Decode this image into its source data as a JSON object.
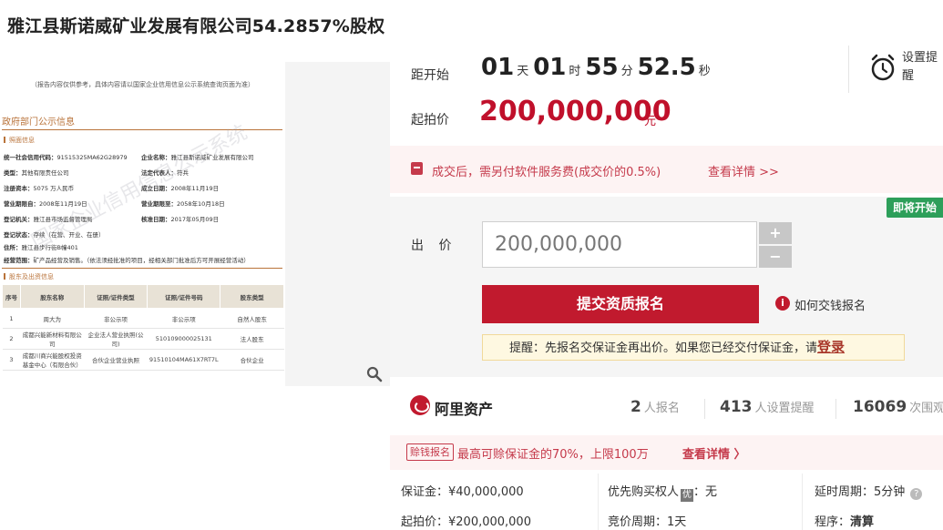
{
  "page": {
    "title": "雅江县斯诺威矿业发展有限公司54.2857%股权"
  },
  "document": {
    "note": "（报告内容仅供参考，具体内容请以国家企业信用信息公示系统查询页面为准）",
    "section_title": "政府部门公示信息",
    "license_section": "照面信息",
    "fields": [
      {
        "label": "统一社会信用代码：",
        "value": "91515325MA62G28979"
      },
      {
        "label": "企业名称：",
        "value": "雅江县斯诺威矿业发展有限公司"
      },
      {
        "label": "类型：",
        "value": "其他有限责任公司"
      },
      {
        "label": "法定代表人：",
        "value": "符兵"
      },
      {
        "label": "注册资本：",
        "value": "5075 万人民币"
      },
      {
        "label": "成立日期：",
        "value": "2008年11月19日"
      },
      {
        "label": "营业期限自：",
        "value": "2008年11月19日"
      },
      {
        "label": "营业期限至：",
        "value": "2058年10月18日"
      },
      {
        "label": "登记机关：",
        "value": "雅江县市场监督管理局"
      },
      {
        "label": "核准日期：",
        "value": "2017年05月09日"
      },
      {
        "label": "登记状态：",
        "value": "存续（在营、开业、在册）"
      },
      {
        "label": "住所：",
        "value": "雅江县步行街B幢401"
      },
      {
        "label": "经营范围：",
        "value": "矿产品经营及销售。（依法须经批准的项目，经相关部门批准后方可开展经营活动）"
      }
    ],
    "shareholder_section": "股东及出资信息",
    "table_headers": [
      "序号",
      "股东名称",
      "证照/证件类型",
      "证照/证件号码",
      "股东类型"
    ],
    "table_rows": [
      [
        "1",
        "周大为",
        "非公示项",
        "非公示项",
        "自然人股东"
      ],
      [
        "2",
        "成都兴能新材料有限公司",
        "企业法人营业执照(公司)",
        "510109000025131",
        "法人股东"
      ],
      [
        "3",
        "成都川商兴能股权投资基金中心（有限合伙）",
        "合伙企业营业执照",
        "91510104MA61X7RT7L",
        "合伙企业"
      ]
    ],
    "watermark": "国家企业信用信息公示系统"
  },
  "countdown": {
    "label": "距开始",
    "days": "01",
    "days_unit": "天",
    "hours": "01",
    "hours_unit": "时",
    "minutes": "55",
    "minutes_unit": "分",
    "seconds": "52.5",
    "seconds_unit": "秒"
  },
  "reminder": {
    "label": "设置提醒"
  },
  "start_price": {
    "label": "起拍价",
    "value": "200,000,000",
    "unit": "元"
  },
  "fee_notice": {
    "text": "成交后，需另付软件服务费(成交价的0.5%)",
    "link": "查看详情 >>"
  },
  "bid": {
    "badge": "即将开始",
    "label": "出 价",
    "value": "200,000,000",
    "plus": "+",
    "minus": "−",
    "submit": "提交资质报名",
    "how_to": "如何交钱报名",
    "tip_prefix": "提醒：先报名交保证金再出价。如果您已经交付保证金，请",
    "tip_login": "登录"
  },
  "platform": {
    "name": "阿里资产"
  },
  "stats": [
    {
      "num": "2",
      "label": "人报名"
    },
    {
      "num": "413",
      "label": "人设置提醒"
    },
    {
      "num": "16069",
      "label": "次围观"
    }
  ],
  "promo": {
    "tag": "赊钱报名",
    "text": "最高可赊保证金的70%，上限100万",
    "link": "查看详情 〉"
  },
  "info": {
    "deposit": "保证金：¥40,000,000",
    "priority": "优先购买权人",
    "priority_badge": "优",
    "priority_value": "：无",
    "delay": "延时周期：5分钟",
    "start_price": "起拍价：¥200,000,000",
    "bid_cycle": "竞价周期：1天",
    "procedure_label": "程序：",
    "procedure_value": "清算"
  },
  "colors": {
    "accent": "#c11a2e",
    "badge_green": "#2d9f5a",
    "doc_brown": "#b9733a"
  }
}
